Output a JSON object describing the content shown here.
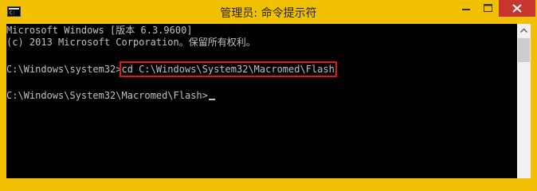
{
  "window": {
    "title": "管理员: 命令提示符",
    "icon": "console-app-icon",
    "buttons": {
      "minimize": "minimize-icon",
      "maximize": "maximize-icon",
      "close": "close-icon"
    },
    "accent_color": "#f1c000",
    "close_color": "#c7362c"
  },
  "console": {
    "lines": [
      "Microsoft Windows [版本 6.3.9600]",
      "(c) 2013 Microsoft Corporation。保留所有权利。"
    ],
    "prompt1": "C:\\Windows\\system32>",
    "command": "cd C:\\Windows\\System32\\Macromed\\Flash",
    "prompt2": "C:\\Windows\\System32\\Macromed\\Flash>",
    "text_color": "#c0c0c0",
    "highlight_color": "#e01818"
  }
}
